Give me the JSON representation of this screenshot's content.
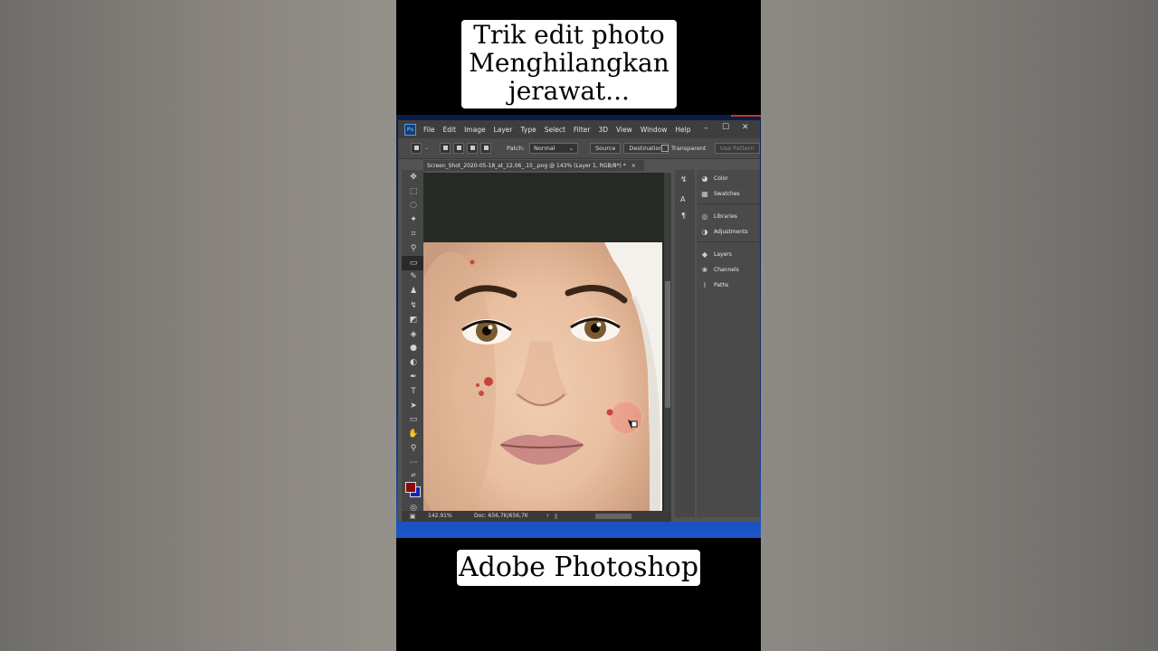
{
  "caption": {
    "top_line1": "Trik edit photo",
    "top_line2": "Menghilangkan",
    "top_line3": "jerawat...",
    "bottom": "Adobe Photoshop"
  },
  "app": {
    "logo": "Ps",
    "menu": [
      "File",
      "Edit",
      "Image",
      "Layer",
      "Type",
      "Select",
      "Filter",
      "3D",
      "View",
      "Window",
      "Help"
    ],
    "window_controls": {
      "minimize": "–",
      "maximize": "☐",
      "close": "✕"
    }
  },
  "options_bar": {
    "patch_label": "Patch:",
    "patch_value": "Normal",
    "source_label": "Source",
    "destination_label": "Destination",
    "transparent_label": "Transparent",
    "use_pattern_label": "Use Pattern"
  },
  "document": {
    "tab_title": "Screen_Shot_2020-05-18_at_12.06_.15_.png @ 143% (Layer 1, RGB/8*) *",
    "close_glyph": "×"
  },
  "status": {
    "zoom": "142.91%",
    "doc": "Doc: 656,7K/656,7K"
  },
  "panels": [
    {
      "icon": "color-icon",
      "label": "Color"
    },
    {
      "icon": "swatches-icon",
      "label": "Swatches"
    },
    {
      "icon": "libraries-icon",
      "label": "Libraries"
    },
    {
      "icon": "adjustments-icon",
      "label": "Adjustments"
    },
    {
      "icon": "layers-icon",
      "label": "Layers"
    },
    {
      "icon": "channels-icon",
      "label": "Channels"
    },
    {
      "icon": "paths-icon",
      "label": "Paths"
    }
  ],
  "colors": {
    "foreground": "#8b0a0a",
    "background": "#1622b8",
    "ps_dark": "#3e3e3e",
    "ps_panel": "#4a4a4a"
  }
}
